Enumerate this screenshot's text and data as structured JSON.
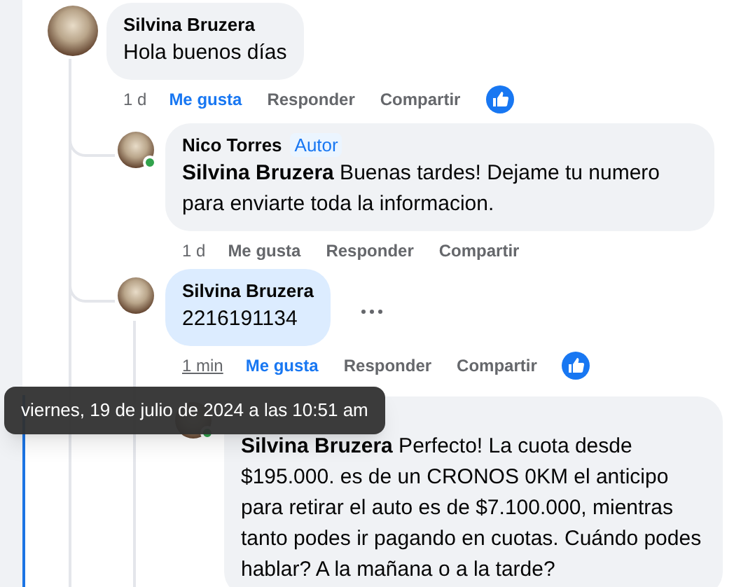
{
  "comments": [
    {
      "author": "Silvina Bruzera",
      "text": "Hola buenos días",
      "highlighted": false,
      "online": false,
      "time": "1 d",
      "time_hovered": false,
      "liked": true,
      "like_label": "Me gusta",
      "reply_label": "Responder",
      "share_label": "Compartir",
      "has_reaction": true,
      "more": false,
      "children": [
        {
          "author": "Nico Torres",
          "badge": "Autor",
          "text": "**Silvina Bruzera** Buenas tardes! Dejame tu numero para enviarte toda la informacion.",
          "highlighted": false,
          "online": true,
          "time": "1 d",
          "time_hovered": false,
          "liked": false,
          "like_label": "Me gusta",
          "reply_label": "Responder",
          "share_label": "Compartir",
          "has_reaction": false,
          "more": false
        },
        {
          "author": "Silvina Bruzera",
          "text": "2216191134",
          "highlighted": true,
          "online": false,
          "time": "1 min",
          "time_hovered": true,
          "liked": true,
          "like_label": "Me gusta",
          "reply_label": "Responder",
          "share_label": "Compartir",
          "has_reaction": true,
          "more": true,
          "children": [
            {
              "text": "**Silvina Bruzera** Perfecto! La cuota desde $195.000. es de un CRONOS 0KM el anticipo para retirar el auto es de $7.100.000, mientras tanto podes ir pagando en cuotas. Cuándo podes hablar? A la mañana o a la tarde?",
              "highlighted": false,
              "online": true
            }
          ]
        }
      ]
    }
  ],
  "tooltip": {
    "text": "viernes, 19 de julio de 2024 a las 10:51 am"
  }
}
